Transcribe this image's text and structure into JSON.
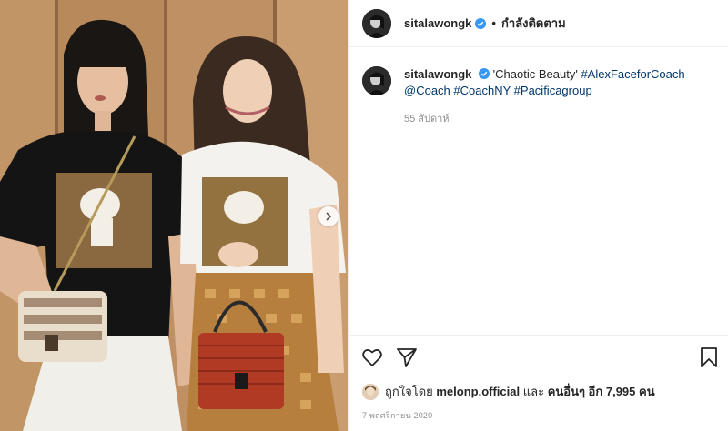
{
  "post": {
    "image_alt": "Two women posing with Coach bags",
    "carousel_next": "next"
  },
  "header": {
    "username": "sitalawongk",
    "separator": "•",
    "follow_status": "กำลังติดตาม"
  },
  "caption": {
    "username": "sitalawongk",
    "text": "'Chaotic Beauty'",
    "tags": [
      "#AlexFaceforCoach",
      "@Coach",
      "#CoachNY",
      "#Pacificagroup"
    ],
    "time_ago": "55 สัปดาห์"
  },
  "actions": {
    "like_icon": "heart-icon",
    "share_icon": "send-icon",
    "save_icon": "bookmark-icon"
  },
  "likes": {
    "prefix": "ถูกใจโดย",
    "user": "melonp.official",
    "middle": "และ",
    "others": "คนอื่นๆ อีก 7,995 คน"
  },
  "date": "7 พฤศจิกายน 2020",
  "colors": {
    "verified": "#3897f0",
    "link": "#00376b",
    "muted": "#8e8e8e",
    "divider": "#efefef"
  }
}
